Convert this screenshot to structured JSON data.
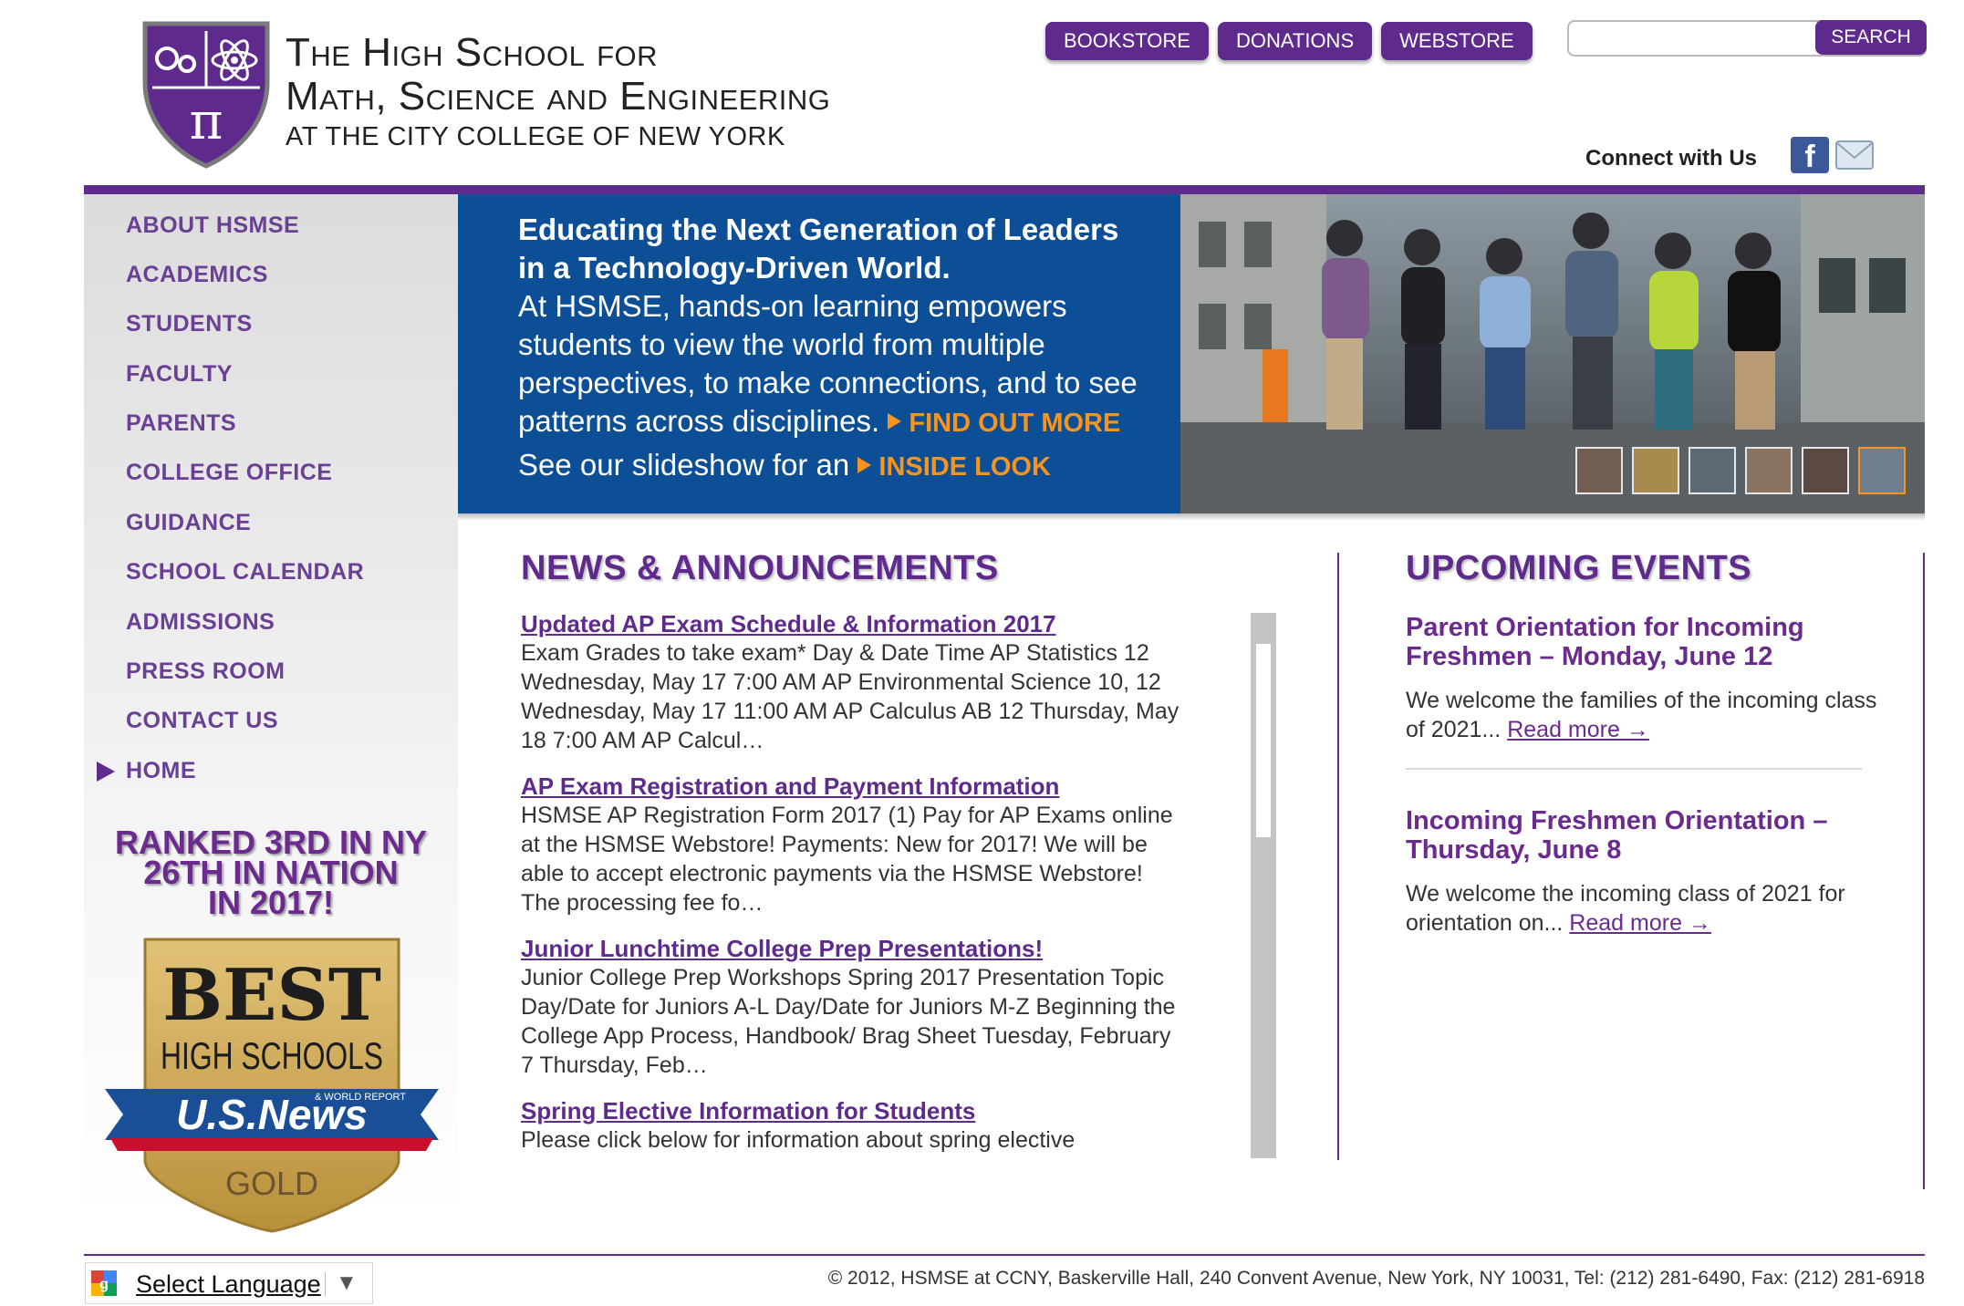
{
  "header": {
    "logo_line1": "The High School for",
    "logo_line2": "Math, Science and Engineering",
    "logo_line3": "AT THE CITY COLLEGE OF NEW YORK",
    "logo_symbol": "π",
    "buttons": [
      "BOOKSTORE",
      "DONATIONS",
      "WEBSTORE"
    ],
    "search": {
      "placeholder": "",
      "button_label": "SEARCH"
    },
    "connect_label": "Connect with Us",
    "social_icons": [
      "facebook-icon",
      "mail-icon"
    ]
  },
  "sidebar": {
    "items": [
      {
        "label": "ABOUT HSMSE",
        "active": false
      },
      {
        "label": "ACADEMICS",
        "active": false
      },
      {
        "label": "STUDENTS",
        "active": false
      },
      {
        "label": "FACULTY",
        "active": false
      },
      {
        "label": "PARENTS",
        "active": false
      },
      {
        "label": "COLLEGE OFFICE",
        "active": false
      },
      {
        "label": "GUIDANCE",
        "active": false
      },
      {
        "label": "SCHOOL CALENDAR",
        "active": false
      },
      {
        "label": "ADMISSIONS",
        "active": false
      },
      {
        "label": "PRESS ROOM",
        "active": false
      },
      {
        "label": "CONTACT US",
        "active": false
      },
      {
        "label": "HOME",
        "active": true
      }
    ],
    "ranked_line1": "RANKED 3RD IN NY",
    "ranked_line2": "26TH IN NATION",
    "ranked_line3": "IN 2017!",
    "badge": {
      "line1": "BEST",
      "line2": "HIGH SCHOOLS",
      "brand": "U.S.News",
      "brand_sub": "& WORLD REPORT",
      "tier": "GOLD"
    }
  },
  "hero": {
    "headline_line1": "Educating the Next Generation of Leaders",
    "headline_line2": "in a Technology-Driven World.",
    "body_line1": "At HSMSE, hands-on learning empowers",
    "body_line2": "students to view the world from multiple",
    "body_line3": "perspectives, to make connections, and to see",
    "body_line4": "patterns across disciplines.",
    "link1": "FIND OUT MORE",
    "slideshow_text": "See our slideshow for an",
    "link2": "INSIDE LOOK",
    "thumbnail_count": 6,
    "active_thumbnail": 6
  },
  "news": {
    "title": "NEWS & ANNOUNCEMENTS",
    "items": [
      {
        "title": "Updated AP Exam Schedule & Information 2017",
        "body": "Exam Grades to take exam* Day & Date Time AP Statistics 12 Wednesday, May 17 7:00 AM AP Environmental Science 10, 12 Wednesday, May 17 11:00 AM AP Calculus AB 12 Thursday, May 18 7:00 AM AP Calcul…"
      },
      {
        "title": "AP Exam Registration and Payment Information",
        "body": "HSMSE AP Registration Form 2017 (1)  Pay for AP Exams online at the HSMSE Webstore! Payments: New for 2017! We will be able to accept electronic payments via the HSMSE Webstore! The processing fee fo…"
      },
      {
        "title": "Junior Lunchtime College Prep Presentations!",
        "body": "Junior College Prep Workshops Spring 2017 Presentation Topic Day/Date for Juniors A-L Day/Date for Juniors M-Z Beginning the College App Process, Handbook/ Brag Sheet Tuesday, February 7 Thursday, Feb…"
      },
      {
        "title": "Spring Elective Information for Students",
        "body": "Please click below for information about spring elective"
      }
    ]
  },
  "events": {
    "title": "UPCOMING EVENTS",
    "items": [
      {
        "title": "Parent Orientation for Incoming Freshmen – Monday, June 12",
        "body": "We welcome the families of the incoming class of 2021...",
        "link": "Read more →"
      },
      {
        "title": "Incoming Freshmen Orientation – Thursday, June 8",
        "body": "We welcome the incoming class of 2021 for orientation on...",
        "link": "Read more →"
      }
    ]
  },
  "footer": {
    "language_label": "Select Language",
    "language_arrow": "▼",
    "copyright": "© 2012, HSMSE at CCNY, Baskerville Hall, 240 Convent Avenue, New York, NY 10031, Tel: (212) 281-6490, Fax: (212) 281-6918"
  },
  "colors": {
    "brand_purple": "#5e2b8c",
    "hero_blue": "#0d4f97",
    "accent_orange": "#f7941d"
  }
}
